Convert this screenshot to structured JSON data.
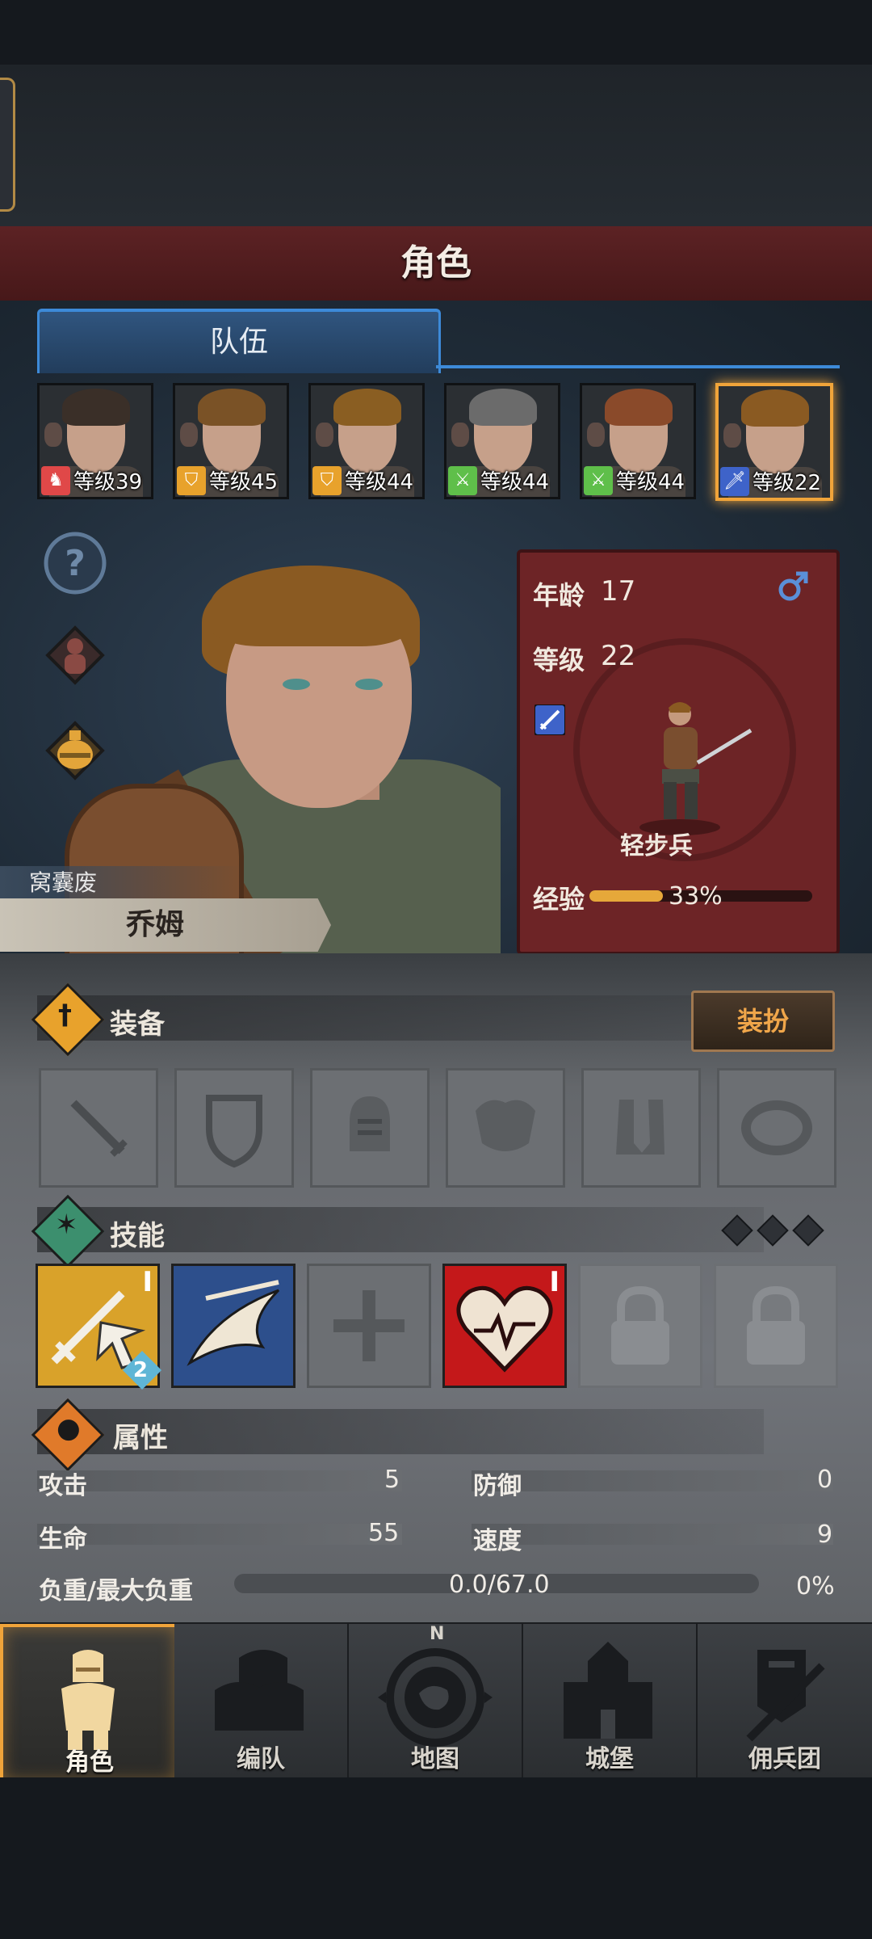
{
  "header": {
    "title": "角色"
  },
  "tabs": [
    {
      "label": "队伍",
      "active": true
    }
  ],
  "team": [
    {
      "level_label": "等级39",
      "class_icon": "horse-icon",
      "class_color": "#e04848",
      "hair": "#3a2f28",
      "selected": false
    },
    {
      "level_label": "等级45",
      "class_icon": "shield-icon",
      "class_color": "#e8a22c",
      "hair": "#7a5226",
      "selected": false
    },
    {
      "level_label": "等级44",
      "class_icon": "shield-icon",
      "class_color": "#e8a22c",
      "hair": "#8a5e22",
      "selected": false
    },
    {
      "level_label": "等级44",
      "class_icon": "crossed-swords-icon",
      "class_color": "#5fbf4a",
      "hair": "#6b6b6b",
      "selected": false
    },
    {
      "level_label": "等级44",
      "class_icon": "crossed-swords-icon",
      "class_color": "#5fbf4a",
      "hair": "#8a4a2a",
      "selected": false
    },
    {
      "level_label": "等级22",
      "class_icon": "sword-icon",
      "class_color": "#3e63c9",
      "hair": "#8a5a22",
      "selected": true
    }
  ],
  "character": {
    "trait": "窝囊废",
    "name": "乔姆",
    "age_label": "年龄",
    "age": "17",
    "level_label": "等级",
    "level": "22",
    "gender_icon": "male-icon",
    "class_name": "轻步兵",
    "exp_label": "经验",
    "exp_value": "33%",
    "exp_fraction": 0.33
  },
  "equipment": {
    "title": "装备",
    "dress_button": "装扮",
    "slots": [
      "sword-slot-icon",
      "shield-slot-icon",
      "helmet-slot-icon",
      "armor-slot-icon",
      "boots-slot-icon",
      "ring-slot-icon"
    ]
  },
  "skills": {
    "title": "技能",
    "items": [
      {
        "icon": "sword-attack-skill-icon",
        "rank": "I",
        "badge": "2",
        "state": "active"
      },
      {
        "icon": "charge-skill-icon",
        "rank": "",
        "badge": "",
        "state": "active"
      },
      {
        "icon": "cross-empty-slot-icon",
        "rank": "",
        "badge": "",
        "state": "empty"
      },
      {
        "icon": "heart-skill-icon",
        "rank": "I",
        "badge": "",
        "state": "active"
      },
      {
        "icon": "lock-icon",
        "rank": "",
        "badge": "",
        "state": "locked"
      },
      {
        "icon": "lock-icon",
        "rank": "",
        "badge": "",
        "state": "locked"
      }
    ]
  },
  "attributes": {
    "title": "属性",
    "attack_label": "攻击",
    "attack_value": "5",
    "defense_label": "防御",
    "defense_value": "0",
    "hp_label": "生命",
    "hp_value": "55",
    "speed_label": "速度",
    "speed_value": "9",
    "weight_label": "负重/最大负重",
    "weight_value": "0.0/67.0",
    "weight_percent": "0%"
  },
  "nav": [
    {
      "label": "角色",
      "icon": "knight-icon",
      "active": true
    },
    {
      "label": "编队",
      "icon": "squad-icon",
      "active": false
    },
    {
      "label": "地图",
      "icon": "compass-map-icon",
      "active": false,
      "compass_letter": "N"
    },
    {
      "label": "城堡",
      "icon": "castle-icon",
      "active": false
    },
    {
      "label": "佣兵团",
      "icon": "mercenary-banner-icon",
      "active": false
    }
  ]
}
